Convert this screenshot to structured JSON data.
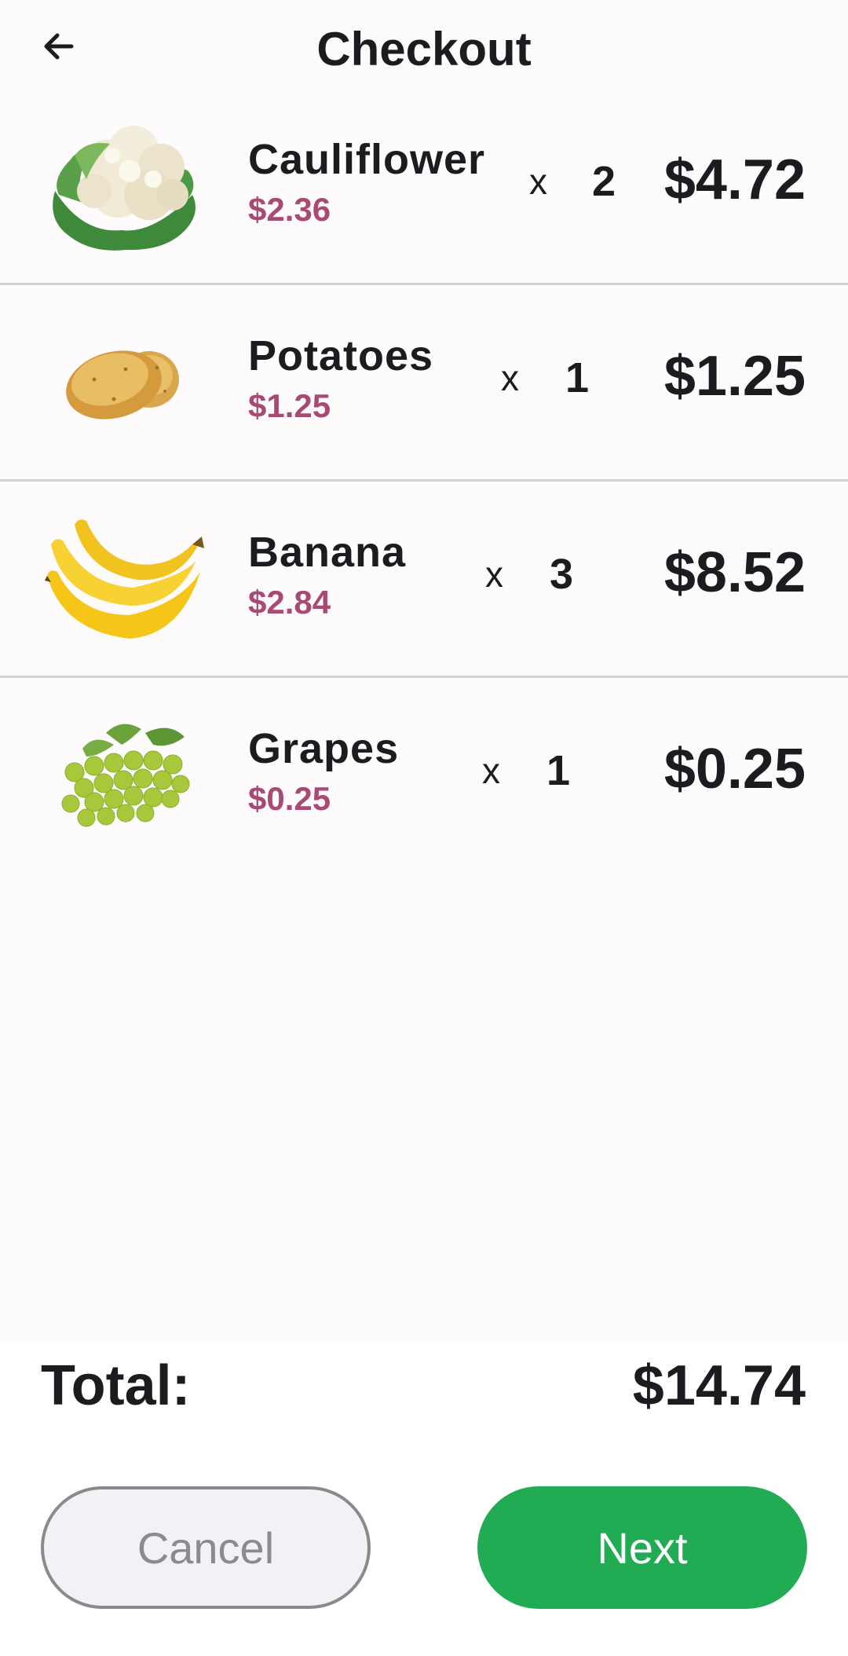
{
  "header": {
    "title": "Checkout",
    "back_icon": "arrow-left-icon"
  },
  "items": [
    {
      "name": "Cauliflower",
      "unit_price": "$2.36",
      "times": "x",
      "quantity": "2",
      "line_total": "$4.72",
      "image": "cauliflower-image"
    },
    {
      "name": "Potatoes",
      "unit_price": "$1.25",
      "times": "x",
      "quantity": "1",
      "line_total": "$1.25",
      "image": "potatoes-image"
    },
    {
      "name": "Banana",
      "unit_price": "$2.84",
      "times": "x",
      "quantity": "3",
      "line_total": "$8.52",
      "image": "banana-image"
    },
    {
      "name": "Grapes",
      "unit_price": "$0.25",
      "times": "x",
      "quantity": "1",
      "line_total": "$0.25",
      "image": "grapes-image"
    }
  ],
  "summary": {
    "total_label": "Total:",
    "total_value": "$14.74"
  },
  "actions": {
    "cancel_label": "Cancel",
    "next_label": "Next"
  },
  "colors": {
    "accent_green": "#21ab52",
    "unit_price": "#a84a74",
    "background": "#fefbfd"
  }
}
